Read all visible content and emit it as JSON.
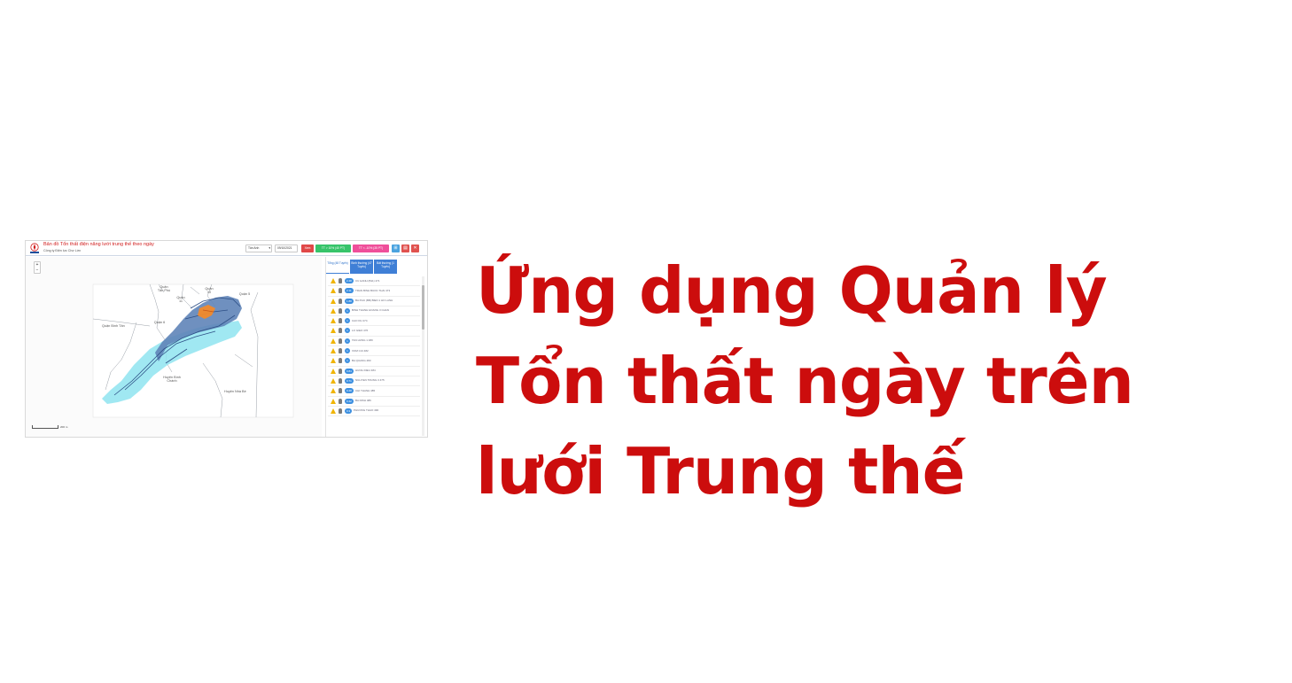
{
  "headline": {
    "line1": "Ứng dụng Quản lý",
    "line2": "Tổn thất ngày trên",
    "line3": "lưới Trung thế",
    "color": "#cc0d0d"
  },
  "app": {
    "title": "Bản đồ Tổn thất điện năng lưới trung thế theo ngày",
    "subtitle": "Công ty Điện lực Chợ Lớn",
    "header": {
      "unit_select": "Tân Anh",
      "date_field": "09/10/2021",
      "buttons": [
        {
          "label": "Xem",
          "color": "#e04848"
        },
        {
          "label": "TT > 10% (40 PT)",
          "color": "#37c46a"
        },
        {
          "label": "TT < -10% (35 PT)",
          "color": "#ef4f9a"
        }
      ],
      "icons": [
        {
          "name": "map-icon",
          "glyph": "⊞",
          "color": "#4aa3df"
        },
        {
          "name": "table-icon",
          "glyph": "▤",
          "color": "#e0524f"
        },
        {
          "name": "close-icon",
          "glyph": "✕",
          "color": "#e0524f"
        }
      ]
    },
    "zoom": {
      "plus": "+",
      "minus": "−"
    },
    "map_labels": [
      "Quận Tân Phú",
      "Quận 10",
      "Quận 11",
      "Quận 5",
      "Quận 6",
      "Quận Bình Tân",
      "Huyện Bình Chánh",
      "Huyện Nhà Bè"
    ],
    "panel": {
      "tabs": [
        "Tổng (48 Tuyến)",
        "Bình thường (47 Tuyến)",
        "Bất thường (1 Tuyến)"
      ],
      "feeders": [
        {
          "badge": "2.48",
          "name": "CU HANH (B11) 471"
        },
        {
          "badge": "2.11",
          "name": "TRAN BINH BUOC THAI 473"
        },
        {
          "badge": "1.88",
          "name": "BA PHU (BB) BIEN 1 HO LANH"
        },
        {
          "badge": "1",
          "name": "BINH THANH HOANG 3 CHAN"
        },
        {
          "badge": "1",
          "name": "CAO DU 474"
        },
        {
          "badge": "1",
          "name": "LO GIEO 476"
        },
        {
          "badge": "1",
          "name": "TAN HUNG 1 480"
        },
        {
          "badge": "1",
          "name": "XOM CUI 482"
        },
        {
          "badge": "1",
          "name": "BA QUANG 483"
        },
        {
          "badge": "0.84",
          "name": "HUNG DIEU 484"
        },
        {
          "badge": "0.71",
          "name": "NGUYEN TRUNG 3 475"
        },
        {
          "badge": "0.48",
          "name": "CHI THANH 485"
        },
        {
          "badge": "0.42",
          "name": "BA DINH 486"
        },
        {
          "badge": "0.3",
          "name": "PHUONG THAO 490"
        }
      ]
    },
    "scale": "200 m"
  }
}
